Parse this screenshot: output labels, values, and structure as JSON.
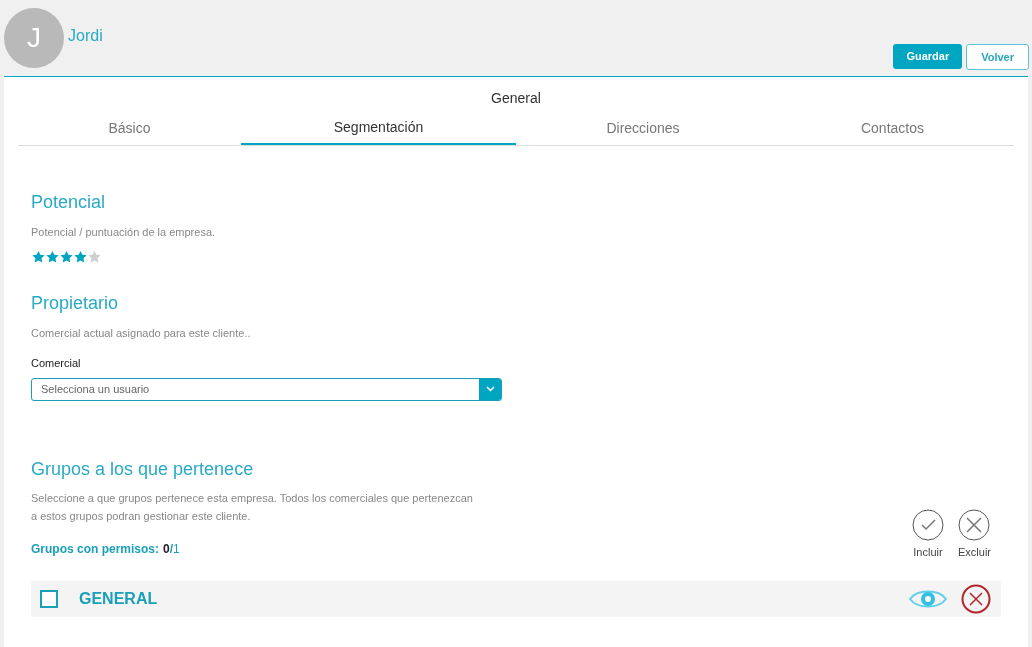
{
  "header": {
    "avatar_initial": "J",
    "name": "Jordi",
    "buttons": [
      {
        "label": "Guardar",
        "kind": "primary"
      },
      {
        "label": "Volver",
        "kind": "secondary"
      }
    ]
  },
  "panel_title": "General",
  "tabs": [
    {
      "label": "Básico",
      "selected": false
    },
    {
      "label": "Segmentación",
      "selected": true
    },
    {
      "label": "Direcciones",
      "selected": false
    },
    {
      "label": "Contactos",
      "selected": false
    }
  ],
  "potencial": {
    "title": "Potencial",
    "description": "Potencial / puntuación de la empresa.",
    "stars": 4
  },
  "propietario": {
    "title": "Propietario",
    "description": "Comercial actual asignado para este cliente..",
    "field_label": "Comercial",
    "placeholder": "Selecciona un usuario"
  },
  "grupos": {
    "title": "Grupos a los que pertenece",
    "description": "Seleccione a que grupos pertenece esta empresa. Todos los comerciales que pertenezcan a estos grupos podran gestionar este cliente.",
    "count_label": "Grupos con permisos:",
    "count_value": "0",
    "count_sep": "/",
    "count_total": "1",
    "actions": [
      "Incluir",
      "Excluir"
    ],
    "rows": [
      {
        "name": "GENERAL",
        "checked": false
      }
    ]
  }
}
